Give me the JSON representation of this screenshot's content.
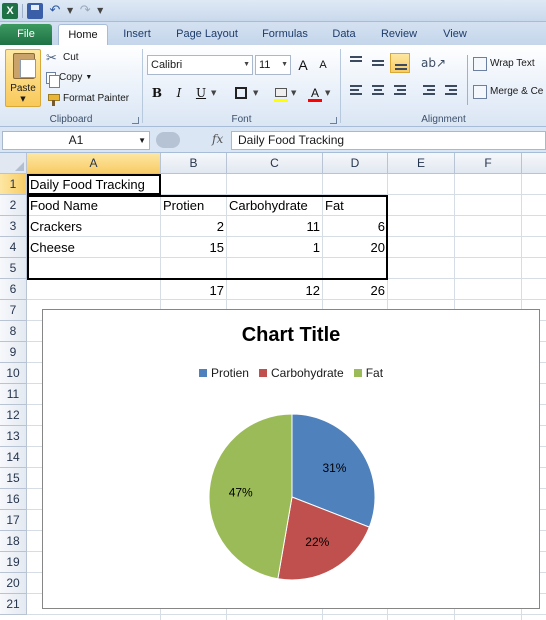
{
  "app": {
    "icon_letter": "X"
  },
  "tabs": [
    {
      "label": "File"
    },
    {
      "label": "Home"
    },
    {
      "label": "Insert"
    },
    {
      "label": "Page Layout"
    },
    {
      "label": "Formulas"
    },
    {
      "label": "Data"
    },
    {
      "label": "Review"
    },
    {
      "label": "View"
    }
  ],
  "ribbon": {
    "clipboard": {
      "paste": "Paste",
      "cut": "Cut",
      "copy": "Copy",
      "format_painter": "Format Painter",
      "label": "Clipboard"
    },
    "font": {
      "name": "Calibri",
      "size": "11",
      "grow": "A",
      "shrink": "A",
      "bold": "B",
      "italic": "I",
      "underline": "U",
      "font_color": "A",
      "label": "Font"
    },
    "alignment": {
      "wrap_text": "Wrap Text",
      "merge": "Merge & Ce",
      "label": "Alignment"
    }
  },
  "formula_bar": {
    "name_box": "A1",
    "fx": "fx",
    "content": "Daily Food Tracking"
  },
  "columns": [
    "A",
    "B",
    "C",
    "D",
    "E",
    "F"
  ],
  "rows": [
    "1",
    "2",
    "3",
    "4",
    "5",
    "6",
    "7",
    "8",
    "9",
    "10",
    "11",
    "12",
    "13",
    "14",
    "15",
    "16",
    "17",
    "18",
    "19",
    "20",
    "21"
  ],
  "cells": {
    "a1": "Daily Food Tracking",
    "a2": "Food Name",
    "b2": "Protien",
    "c2": "Carbohydrate",
    "d2": "Fat",
    "a3": "Crackers",
    "b3": "2",
    "c3": "11",
    "d3": "6",
    "a4": "Cheese",
    "b4": "15",
    "c4": "1",
    "d4": "20",
    "b6": "17",
    "c6": "12",
    "d6": "26"
  },
  "chart_data": {
    "type": "pie",
    "title": "Chart Title",
    "categories": [
      "Protien",
      "Carbohydrate",
      "Fat"
    ],
    "values": [
      17,
      12,
      26
    ],
    "percent_labels": [
      "31%",
      "22%",
      "47%"
    ],
    "colors": [
      "#4f81bd",
      "#c0504d",
      "#9bbb59"
    ],
    "legend": "top"
  }
}
